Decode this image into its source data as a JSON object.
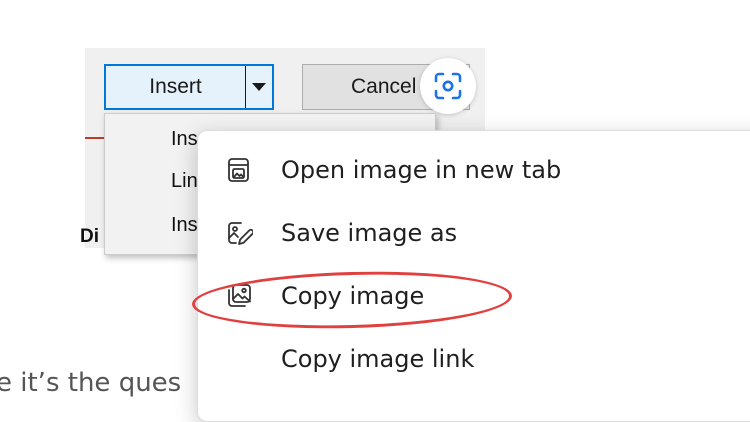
{
  "dialog": {
    "insert_label": "Insert",
    "cancel_label": "Cancel",
    "dropdown_items": [
      "Ins",
      "Lin",
      "Ins"
    ],
    "fragment_text": "Di"
  },
  "article": {
    "text": "e it’s the ques"
  },
  "context_menu": {
    "items": [
      {
        "label": "Open image in new tab",
        "icon": "open-in-new-tab-icon"
      },
      {
        "label": "Save image as",
        "icon": "save-image-icon"
      },
      {
        "label": "Copy image",
        "icon": "copy-image-icon"
      },
      {
        "label": "Copy image link",
        "icon": ""
      }
    ]
  },
  "colors": {
    "accent": "#0078d7",
    "highlight": "#e0403e",
    "visual_search": "#1a73e8"
  }
}
